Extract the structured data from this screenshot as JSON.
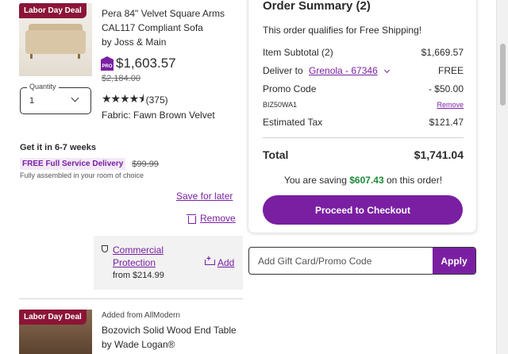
{
  "item1": {
    "badge": "Labor Day Deal",
    "name": "Pera 84\" Velvet Square Arms CAL117 Compliant Sofa",
    "brand": "by Joss & Main",
    "pro_badge": "PRO",
    "price": "$1,603.57",
    "was_price": "$2,184.00",
    "rating_stars": 4.5,
    "rating_count": "(375)",
    "fabric": "Fabric: Fawn Brown Velvet",
    "quantity_label": "Quantity",
    "quantity_value": "1",
    "delivery_title": "Get it in 6-7 weeks",
    "delivery_tag": "FREE Full Service Delivery",
    "delivery_old_price": "$99.99",
    "delivery_note": "Fully assembled in your room of choice",
    "save_for_later": "Save for later",
    "remove": "Remove",
    "protection_link": "Commercial Protection",
    "protection_price": "from $214.99",
    "protection_add": "Add"
  },
  "item2": {
    "badge": "Labor Day Deal",
    "added_from": "Added from AllModern",
    "name": "Bozovich Solid Wood End Table",
    "brand": "by Wade Logan®"
  },
  "summary": {
    "title": "Order Summary (2)",
    "free_shipping": "This order qualifies for Free Shipping!",
    "subtotal_label": "Item Subtotal (2)",
    "subtotal_value": "$1,669.57",
    "deliver_label": "Deliver to",
    "deliver_location": "Grenola - 67346",
    "deliver_value": "FREE",
    "promo_label": "Promo Code",
    "promo_value": "- $50.00",
    "promo_code": "BIZ50WA1",
    "promo_remove": "Remove",
    "tax_label": "Estimated Tax",
    "tax_value": "$121.47",
    "total_label": "Total",
    "total_value": "$1,741.04",
    "saving_prefix": "You are saving",
    "saving_amount": "$607.43",
    "saving_suffix": "on this order!",
    "checkout_label": "Proceed to Checkout"
  },
  "promo_box": {
    "placeholder": "Add Gift Card/Promo Code",
    "apply_label": "Apply"
  },
  "colors": {
    "accent": "#7a1fa2",
    "badge": "#8b1538",
    "savings": "#1f8a3a"
  }
}
